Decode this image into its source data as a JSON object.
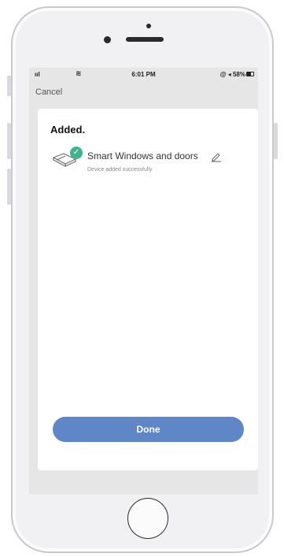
{
  "status_bar": {
    "signal": "ııl",
    "wifi": "≋",
    "time": "6:01 PM",
    "right_info": "@ ◂ 58%",
    "battery_percent": 58
  },
  "nav": {
    "cancel_label": "Cancel"
  },
  "card": {
    "title": "Added.",
    "device": {
      "name": "Smart Windows and doors",
      "status": "Device added successfully",
      "icon": "window-sensor-icon",
      "badge_icon": "check-icon",
      "edit_icon": "pencil-icon"
    }
  },
  "actions": {
    "done_label": "Done"
  },
  "colors": {
    "accent": "#5f86c6",
    "success": "#3db68f",
    "screen_bg": "#e6e6e6",
    "card_bg": "#ffffff"
  }
}
